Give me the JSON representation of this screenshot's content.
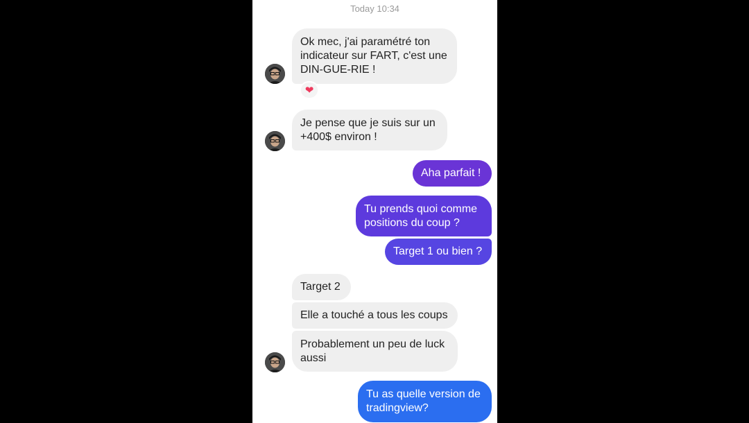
{
  "conversation": {
    "timestamp": "Today 10:34",
    "reaction_icon": "heart-icon",
    "colors": {
      "incoming_bubble": "#efefef",
      "purple_bubble": "#6a34d6",
      "indigo_bubble": "#5a40e0",
      "blue_bubble": "#2b6ef0",
      "reaction_heart": "#ee3a5d"
    },
    "messages": [
      {
        "side": "incoming",
        "text": "Ok mec, j'ai paramétré ton\nindicateur sur FART, c'est une\nDIN-GUE-RIE !"
      },
      {
        "side": "incoming",
        "text": "Je pense que je suis sur un\n+400$ environ !"
      },
      {
        "side": "outgoing",
        "text": "Aha parfait !"
      },
      {
        "side": "outgoing",
        "text": "Tu prends quoi comme\npositions du coup ?"
      },
      {
        "side": "outgoing",
        "text": "Target 1 ou bien ?"
      },
      {
        "side": "incoming",
        "text": "Target 2"
      },
      {
        "side": "incoming",
        "text": "Elle a touché a tous les coups"
      },
      {
        "side": "incoming",
        "text": "Probablement un peu de luck\naussi"
      },
      {
        "side": "outgoing",
        "text": "Tu as quelle version de\ntradingview?"
      }
    ]
  }
}
